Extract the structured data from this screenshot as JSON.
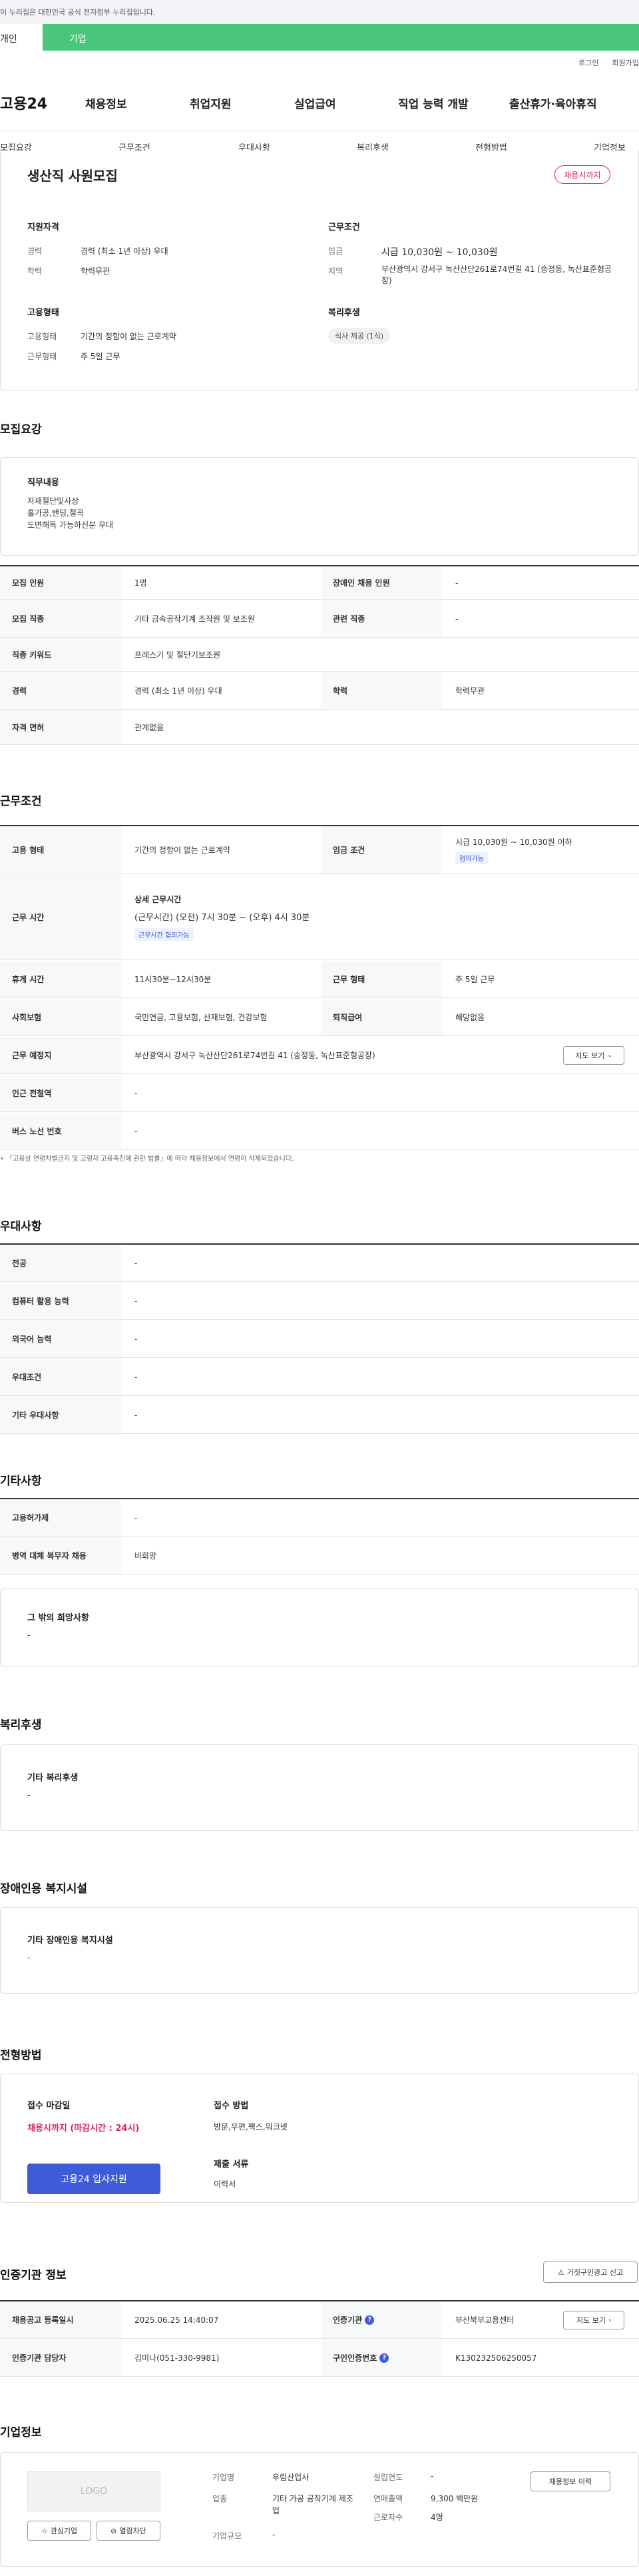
{
  "notice": "이 누리집은 대한민국 공식 전자정부 누리집입니다.",
  "user_tabs": [
    "개인",
    "기업"
  ],
  "utility": [
    "로그인",
    "회원가입"
  ],
  "logo": "고용24",
  "gnb": [
    "채용정보",
    "취업지원",
    "실업급여",
    "직업 능력 개발",
    "출산휴가·육아휴직"
  ],
  "snb": [
    "모집요강",
    "근무조건",
    "우대사항",
    "복리후생",
    "전형방법",
    "기업정보"
  ],
  "job": {
    "title": "생산직 사원모집",
    "status": "채용시까지",
    "qual_title": "지원자격",
    "qual": [
      {
        "k": "경력",
        "v": "경력 (최소 1년 이상) 우대"
      },
      {
        "k": "학력",
        "v": "학력무관"
      }
    ],
    "cond_title": "근무조건",
    "cond": [
      {
        "k": "임금",
        "v": "시급 10,030원 ~ 10,030원"
      },
      {
        "k": "지역",
        "v": "부산광역시 강서구 녹산산단261로74번길 41 (송정동, 녹산표준형공장)"
      }
    ],
    "emp_title": "고용형태",
    "emp": [
      {
        "k": "고용형태",
        "v": "기간의 정함이 없는 근로계약"
      },
      {
        "k": "근무형태",
        "v": "주 5일 근무"
      }
    ],
    "welfare_title": "복리후생",
    "welfare_tag": "식사 제공 (1식)"
  },
  "recruit": {
    "heading": "모집요강",
    "duty_title": "직무내용",
    "duty_lines": [
      "자재절단및사상",
      "홀가공,밴딩,절곡",
      "도면해독 가능하신분 우대"
    ],
    "rows": [
      {
        "k1": "모집 인원",
        "v1": "1명",
        "k2": "장애인 채용 인원",
        "v2": "-"
      },
      {
        "k1": "모집 직종",
        "v1": "기타 금속공작기계 조작원 및 보조원",
        "k2": "관련 직종",
        "v2": "-"
      },
      {
        "k1": "직종 키워드",
        "v1": "프레스기 및 절단기보조원"
      },
      {
        "k1": "경력",
        "v1": "경력 (최소 1년 이상) 우대",
        "k2": "학력",
        "v2": "학력무관"
      },
      {
        "k1": "자격 면허",
        "v1": "관계없음"
      }
    ]
  },
  "work": {
    "heading": "근무조건",
    "type_k": "고용 형태",
    "type_v": "기간의 정함이 없는 근로계약",
    "wage_k": "임금 조건",
    "wage_v": "시급 10,030원 ~ 10,030원 이하",
    "wage_tag": "협의가능",
    "time_k": "근무 시간",
    "time_title": "상세 근무시간",
    "time_v": "(근무시간) (오전) 7시 30분 ~ (오후) 4시 30분",
    "time_tag": "근무시간 협의가능",
    "rest_k": "휴게 시간",
    "rest_v": "11시30분~12시30분",
    "shape_k": "근무 형태",
    "shape_v": "주 5일 근무",
    "ins_k": "사회보험",
    "ins_v": "국민연금, 고용보험, 산재보험, 건강보험",
    "sev_k": "퇴직급여",
    "sev_v": "해당없음",
    "place_k": "근무 예정지",
    "place_v": "부산광역시 강서구 녹산산단261로74번길 41 (송정동, 녹산표준형공장)",
    "map_btn": "지도 보기",
    "subway_k": "인근 전철역",
    "subway_v": "-",
    "bus_k": "버스 노선 번호",
    "bus_v": "-",
    "footnote": "「고용상 연령차별금지 및 고령자 고용촉진에 관한 법률」에 따라 채용정보에서 연령이 삭제되었습니다."
  },
  "pref": {
    "heading": "우대사항",
    "rows": [
      {
        "k": "전공",
        "v": "-"
      },
      {
        "k": "컴퓨터 활용 능력",
        "v": "-"
      },
      {
        "k": "외국어 능력",
        "v": "-"
      },
      {
        "k": "우대조건",
        "v": "-"
      },
      {
        "k": "기타 우대사항",
        "v": "-"
      }
    ]
  },
  "etc": {
    "heading": "기타사항",
    "rows": [
      {
        "k": "고용허가제",
        "v": "-"
      },
      {
        "k": "병역 대체 복무자 채용",
        "v": "비희망"
      }
    ],
    "wish_title": "그 밖의 희망사항",
    "wish_v": "-"
  },
  "benefit": {
    "heading": "복리후생",
    "title": "기타 복리후생",
    "v": "-"
  },
  "disab": {
    "heading": "장애인용 복지시설",
    "title": "기타 장애인용 복지시설",
    "v": "-"
  },
  "screen": {
    "heading": "전형방법",
    "deadline_title": "접수 마감일",
    "deadline_v": "채용시까지 (마감시간 : 24시)",
    "apply_btn": "고용24 입사지원",
    "method_title": "접수 방법",
    "method_v": "방문,우편,팩스,워크넷",
    "docs_title": "제출 서류",
    "docs_v": "이력서"
  },
  "certify": {
    "heading": "인증기관 정보",
    "report_btn": "거짓구인광고 신고",
    "rows": [
      {
        "k1": "채용공고 등록일시",
        "v1": "2025.06.25 14:40:07",
        "k2": "인증기관",
        "v2": "부산북부고용센터",
        "btn": "지도 보기"
      },
      {
        "k1": "인증기관 담당자",
        "v1": "김미나(051-330-9981)",
        "k2": "구인인증번호",
        "v2": "K130232506250057"
      }
    ]
  },
  "company": {
    "heading": "기업정보",
    "logo": "LOGO",
    "fav_btn": "관심기업",
    "block_btn": "열람차단",
    "history_btn": "채용정보 이력",
    "info": [
      {
        "k": "기업명",
        "v": "우림산업사"
      },
      {
        "k": "업종",
        "v": "기타 가공 공작기계 제조업"
      },
      {
        "k": "기업규모",
        "v": "-"
      }
    ],
    "info2": [
      {
        "k": "설립연도",
        "v": "-"
      },
      {
        "k": "연매출액",
        "v": "9,300 백만원"
      },
      {
        "k": "근로자수",
        "v": "4명"
      }
    ]
  }
}
